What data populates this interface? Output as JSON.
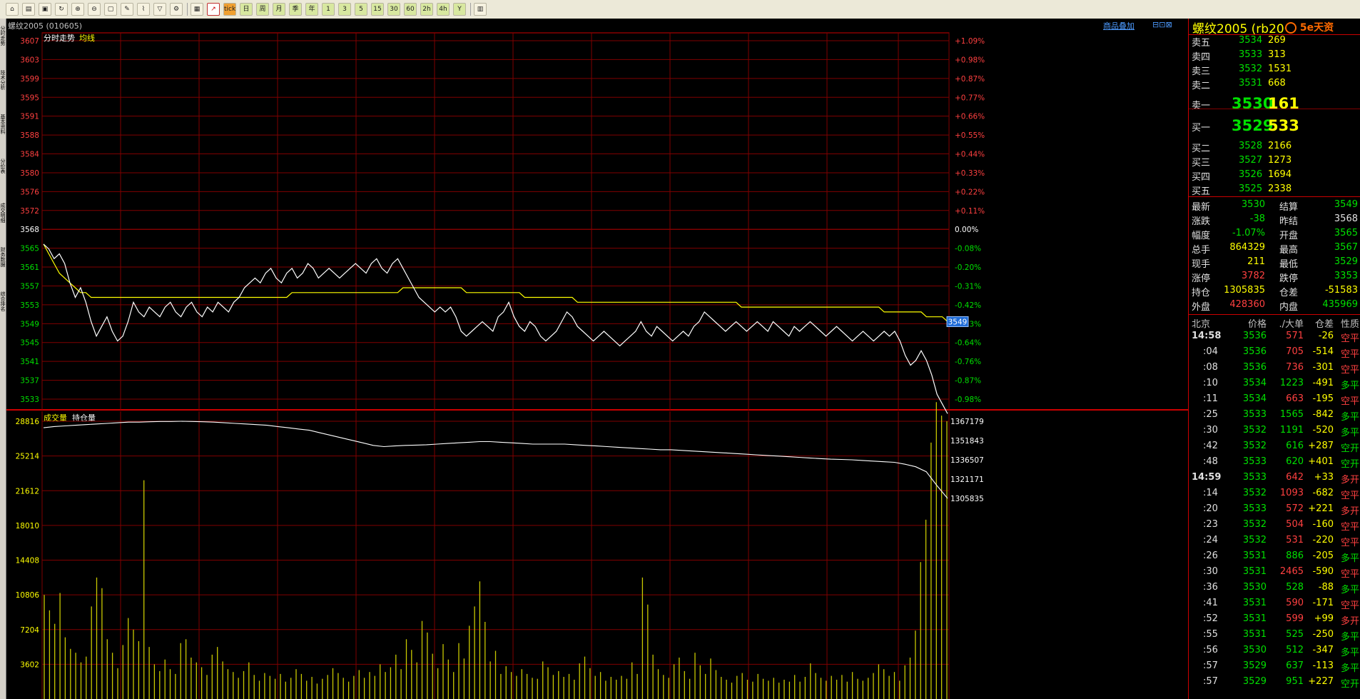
{
  "toolbar": {
    "buttons": [
      "home-icon",
      "book-icon",
      "note-icon",
      "refresh-icon",
      "zoom-in-icon",
      "zoom-out-icon",
      "window-icon",
      "pen-icon",
      "brush-icon",
      "filter-icon",
      "settings-icon",
      "table-icon",
      "chart-icon",
      "tick",
      "日",
      "周",
      "月",
      "季",
      "年",
      "1",
      "3",
      "5",
      "15",
      "30",
      "60",
      "2h",
      "4h",
      "Y",
      "calc-icon"
    ]
  },
  "left_tabs": [
    "分时走势",
    "技术分析",
    "基本资料",
    "分价表",
    "成交明细",
    "财务数据",
    "综合排名"
  ],
  "title": {
    "contract": "螺纹2005 (010605)",
    "overlay_button": "商品叠加",
    "window_buttons": [
      "⊟",
      "⊡",
      "⊠"
    ]
  },
  "chart_labels": {
    "price_panel": "分时走势",
    "avg_line": "均线",
    "vol_panel": "成交量",
    "oi_panel": "持仓量",
    "current_price_tag": "3549"
  },
  "chart_data": {
    "type": "line",
    "price_axis_labels": [
      "3607",
      "3603",
      "3599",
      "3595",
      "3591",
      "3588",
      "3584",
      "3580",
      "3576",
      "3572",
      "3568",
      "3565",
      "3561",
      "3557",
      "3553",
      "3549",
      "3545",
      "3541",
      "3537",
      "3533"
    ],
    "pct_axis_labels": [
      "+1.09%",
      "+0.98%",
      "+0.87%",
      "+0.77%",
      "+0.66%",
      "+0.55%",
      "+0.44%",
      "+0.33%",
      "+0.22%",
      "+0.11%",
      "0.00%",
      "-0.08%",
      "-0.20%",
      "-0.31%",
      "-0.42%",
      "-0.53%",
      "-0.64%",
      "-0.76%",
      "-0.87%",
      "-0.98%"
    ],
    "vol_axis_labels": [
      "28816",
      "25214",
      "21612",
      "18010",
      "14408",
      "10806",
      "7204",
      "3602"
    ],
    "oi_axis_labels": [
      "1367179",
      "1351843",
      "1336507",
      "1321171",
      "1305835"
    ],
    "price_ylim": [
      3531,
      3609
    ],
    "vol_ylim": [
      0,
      30000
    ],
    "oi_ylim": [
      1296000,
      1372000
    ],
    "price_series": [
      3565,
      3564,
      3562,
      3563,
      3561,
      3557,
      3554,
      3556,
      3553,
      3549,
      3546,
      3548,
      3550,
      3547,
      3545,
      3546,
      3549,
      3553,
      3551,
      3550,
      3552,
      3551,
      3550,
      3552,
      3553,
      3551,
      3550,
      3552,
      3553,
      3551,
      3550,
      3552,
      3551,
      3553,
      3552,
      3551,
      3553,
      3554,
      3556,
      3557,
      3558,
      3557,
      3559,
      3560,
      3558,
      3557,
      3559,
      3560,
      3558,
      3559,
      3561,
      3560,
      3558,
      3559,
      3560,
      3559,
      3558,
      3559,
      3560,
      3561,
      3560,
      3559,
      3561,
      3562,
      3560,
      3559,
      3561,
      3562,
      3560,
      3558,
      3556,
      3554,
      3553,
      3552,
      3551,
      3552,
      3551,
      3552,
      3550,
      3547,
      3546,
      3547,
      3548,
      3549,
      3548,
      3547,
      3550,
      3551,
      3553,
      3550,
      3548,
      3547,
      3549,
      3548,
      3546,
      3545,
      3546,
      3547,
      3549,
      3551,
      3550,
      3548,
      3547,
      3546,
      3545,
      3546,
      3547,
      3546,
      3545,
      3544,
      3545,
      3546,
      3547,
      3549,
      3547,
      3546,
      3548,
      3547,
      3546,
      3545,
      3546,
      3547,
      3546,
      3548,
      3549,
      3551,
      3550,
      3549,
      3548,
      3547,
      3548,
      3549,
      3548,
      3547,
      3548,
      3549,
      3548,
      3547,
      3549,
      3548,
      3547,
      3546,
      3548,
      3547,
      3548,
      3549,
      3548,
      3547,
      3546,
      3547,
      3548,
      3547,
      3546,
      3545,
      3546,
      3547,
      3546,
      3545,
      3546,
      3547,
      3546,
      3547,
      3545,
      3542,
      3540,
      3541,
      3543,
      3541,
      3538,
      3534,
      3532,
      3530
    ],
    "avg_series": [
      3565,
      3563,
      3561,
      3559,
      3558,
      3557,
      3556,
      3555,
      3555,
      3554,
      3554,
      3554,
      3554,
      3554,
      3554,
      3554,
      3554,
      3554,
      3554,
      3554,
      3554,
      3554,
      3554,
      3554,
      3554,
      3554,
      3554,
      3554,
      3554,
      3554,
      3554,
      3554,
      3554,
      3554,
      3554,
      3554,
      3554,
      3554,
      3554,
      3554,
      3554,
      3554,
      3554,
      3554,
      3554,
      3554,
      3554,
      3555,
      3555,
      3555,
      3555,
      3555,
      3555,
      3555,
      3555,
      3555,
      3555,
      3555,
      3555,
      3555,
      3555,
      3555,
      3555,
      3555,
      3555,
      3555,
      3555,
      3555,
      3556,
      3556,
      3556,
      3556,
      3556,
      3556,
      3556,
      3556,
      3556,
      3556,
      3556,
      3556,
      3555,
      3555,
      3555,
      3555,
      3555,
      3555,
      3555,
      3555,
      3555,
      3555,
      3555,
      3554,
      3554,
      3554,
      3554,
      3554,
      3554,
      3554,
      3554,
      3554,
      3554,
      3553,
      3553,
      3553,
      3553,
      3553,
      3553,
      3553,
      3553,
      3553,
      3553,
      3553,
      3553,
      3553,
      3553,
      3553,
      3553,
      3553,
      3553,
      3553,
      3553,
      3553,
      3553,
      3553,
      3553,
      3553,
      3553,
      3553,
      3553,
      3553,
      3553,
      3553,
      3552,
      3552,
      3552,
      3552,
      3552,
      3552,
      3552,
      3552,
      3552,
      3552,
      3552,
      3552,
      3552,
      3552,
      3552,
      3552,
      3552,
      3552,
      3552,
      3552,
      3552,
      3552,
      3552,
      3552,
      3552,
      3552,
      3552,
      3551,
      3551,
      3551,
      3551,
      3551,
      3551,
      3551,
      3551,
      3550,
      3550,
      3550,
      3550,
      3549
    ],
    "oi_series": [
      1362000,
      1363000,
      1363500,
      1364000,
      1364500,
      1365000,
      1365500,
      1366000,
      1366500,
      1366500,
      1366800,
      1367000,
      1367000,
      1367179,
      1367000,
      1366800,
      1366500,
      1366000,
      1365500,
      1365000,
      1364500,
      1364000,
      1363000,
      1362000,
      1361000,
      1360000,
      1358000,
      1356000,
      1354000,
      1352000,
      1350000,
      1348000,
      1347000,
      1347500,
      1348000,
      1348200,
      1348500,
      1349000,
      1349500,
      1350000,
      1350500,
      1351000,
      1351000,
      1350500,
      1350000,
      1349500,
      1349000,
      1349000,
      1349000,
      1349000,
      1348500,
      1348000,
      1347500,
      1347000,
      1346500,
      1346000,
      1345500,
      1345000,
      1344500,
      1344500,
      1344000,
      1343500,
      1343000,
      1342500,
      1342000,
      1341500,
      1341000,
      1340500,
      1340000,
      1339500,
      1339000,
      1338500,
      1338000,
      1337500,
      1337000,
      1336800,
      1336500,
      1336000,
      1335500,
      1335000,
      1334500,
      1333000,
      1331000,
      1327000,
      1316000,
      1305835
    ],
    "volume_bars": [
      10800,
      9200,
      7800,
      11000,
      6400,
      5200,
      4800,
      3800,
      4400,
      9600,
      12600,
      11500,
      6200,
      4800,
      3200,
      5600,
      8400,
      7200,
      6000,
      22700,
      5400,
      3600,
      2900,
      4100,
      3100,
      2600,
      5800,
      6200,
      4300,
      3800,
      3300,
      2500,
      4600,
      5400,
      3900,
      3100,
      2800,
      2200,
      2900,
      3800,
      2500,
      1900,
      2700,
      2400,
      2100,
      2600,
      1800,
      2200,
      3100,
      2600,
      1900,
      2300,
      1600,
      2100,
      2500,
      3200,
      2700,
      2200,
      1800,
      2400,
      3000,
      2200,
      2800,
      2400,
      3600,
      2800,
      3300,
      4600,
      3100,
      6200,
      5100,
      3800,
      8100,
      6900,
      4700,
      3200,
      5700,
      4100,
      2800,
      5800,
      4200,
      7600,
      9600,
      12200,
      8000,
      3900,
      5000,
      2600,
      3400,
      2800,
      2400,
      3100,
      2600,
      2200,
      2100,
      3900,
      3300,
      2500,
      2900,
      2300,
      2600,
      2000,
      3700,
      4400,
      3200,
      2400,
      2800,
      1900,
      2300,
      2000,
      2400,
      2100,
      3800,
      2600,
      12600,
      9800,
      4600,
      3100,
      2500,
      2200,
      3600,
      4300,
      2900,
      2100,
      4800,
      3500,
      2600,
      4200,
      3000,
      2300,
      2000,
      1700,
      2400,
      2700,
      2000,
      1800,
      2600,
      2100,
      1900,
      2200,
      1700,
      2000,
      1800,
      2500,
      1800,
      2300,
      3700,
      2700,
      2200,
      1900,
      2400,
      2000,
      2500,
      1800,
      2800,
      2100,
      1900,
      2200,
      2700,
      3600,
      3100,
      2400,
      2800,
      1900,
      3500,
      4300,
      7100,
      14200,
      18600,
      26600,
      30800,
      29400,
      28816
    ]
  },
  "quote": {
    "title": "螺纹2005 (rb2005)",
    "brand": "5e天资",
    "sell": [
      {
        "label": "卖五",
        "price": "3534",
        "vol": "269"
      },
      {
        "label": "卖四",
        "price": "3533",
        "vol": "313"
      },
      {
        "label": "卖三",
        "price": "3532",
        "vol": "1531"
      },
      {
        "label": "卖二",
        "price": "3531",
        "vol": "668"
      },
      {
        "label": "卖一",
        "price": "3530",
        "vol": "161"
      }
    ],
    "buy": [
      {
        "label": "买一",
        "price": "3529",
        "vol": "533"
      },
      {
        "label": "买二",
        "price": "3528",
        "vol": "2166"
      },
      {
        "label": "买三",
        "price": "3527",
        "vol": "1273"
      },
      {
        "label": "买四",
        "price": "3526",
        "vol": "1694"
      },
      {
        "label": "买五",
        "price": "3525",
        "vol": "2338"
      }
    ],
    "stats": [
      {
        "l1": "最新",
        "v1": "3530",
        "c1": "green",
        "l2": "结算",
        "v2": "3549",
        "c2": "green"
      },
      {
        "l1": "涨跌",
        "v1": "-38",
        "c1": "green",
        "l2": "昨结",
        "v2": "3568",
        "c2": "white"
      },
      {
        "l1": "幅度",
        "v1": "-1.07%",
        "c1": "green",
        "l2": "开盘",
        "v2": "3565",
        "c2": "green"
      },
      {
        "l1": "总手",
        "v1": "864329",
        "c1": "yellow",
        "l2": "最高",
        "v2": "3567",
        "c2": "green"
      },
      {
        "l1": "现手",
        "v1": "211",
        "c1": "yellow",
        "l2": "最低",
        "v2": "3529",
        "c2": "green"
      },
      {
        "l1": "涨停",
        "v1": "3782",
        "c1": "red",
        "l2": "跌停",
        "v2": "3353",
        "c2": "green"
      },
      {
        "l1": "持仓",
        "v1": "1305835",
        "c1": "yellow",
        "l2": "仓差",
        "v2": "-51583",
        "c2": "yellow"
      },
      {
        "l1": "外盘",
        "v1": "428360",
        "c1": "red",
        "l2": "内盘",
        "v2": "435969",
        "c2": "green"
      }
    ]
  },
  "ticks_header": {
    "time": "北京",
    "price": "价格",
    "vol": "./大单",
    "diff": "仓差",
    "nature": "性质"
  },
  "ticks": [
    {
      "t": "14:58",
      "p": "3536",
      "v": "571",
      "d": "-26",
      "n": "空平",
      "pc": "green",
      "vc": "red",
      "nc": "red",
      "bold": true
    },
    {
      "t": ":04",
      "p": "3536",
      "v": "705",
      "d": "-514",
      "n": "空平",
      "pc": "green",
      "vc": "red",
      "nc": "red"
    },
    {
      "t": ":08",
      "p": "3536",
      "v": "736",
      "d": "-301",
      "n": "空平",
      "pc": "green",
      "vc": "red",
      "nc": "red"
    },
    {
      "t": ":10",
      "p": "3534",
      "v": "1223",
      "d": "-491",
      "n": "多平",
      "pc": "green",
      "vc": "green",
      "nc": "green"
    },
    {
      "t": ":11",
      "p": "3534",
      "v": "663",
      "d": "-195",
      "n": "空平",
      "pc": "green",
      "vc": "red",
      "nc": "red"
    },
    {
      "t": ":25",
      "p": "3533",
      "v": "1565",
      "d": "-842",
      "n": "多平",
      "pc": "green",
      "vc": "green",
      "nc": "green"
    },
    {
      "t": ":30",
      "p": "3532",
      "v": "1191",
      "d": "-520",
      "n": "多平",
      "pc": "green",
      "vc": "green",
      "nc": "green"
    },
    {
      "t": ":42",
      "p": "3532",
      "v": "616",
      "d": "+287",
      "n": "空开",
      "pc": "green",
      "vc": "green",
      "nc": "green"
    },
    {
      "t": ":48",
      "p": "3533",
      "v": "620",
      "d": "+401",
      "n": "空开",
      "pc": "green",
      "vc": "green",
      "nc": "green"
    },
    {
      "t": "14:59",
      "p": "3533",
      "v": "642",
      "d": "+33",
      "n": "多开",
      "pc": "green",
      "vc": "red",
      "nc": "red",
      "bold": true
    },
    {
      "t": ":14",
      "p": "3532",
      "v": "1093",
      "d": "-682",
      "n": "空平",
      "pc": "green",
      "vc": "red",
      "nc": "red"
    },
    {
      "t": ":20",
      "p": "3533",
      "v": "572",
      "d": "+221",
      "n": "多开",
      "pc": "green",
      "vc": "red",
      "nc": "red"
    },
    {
      "t": ":23",
      "p": "3532",
      "v": "504",
      "d": "-160",
      "n": "空平",
      "pc": "green",
      "vc": "red",
      "nc": "red"
    },
    {
      "t": ":24",
      "p": "3532",
      "v": "531",
      "d": "-220",
      "n": "空平",
      "pc": "green",
      "vc": "red",
      "nc": "red"
    },
    {
      "t": ":26",
      "p": "3531",
      "v": "886",
      "d": "-205",
      "n": "多平",
      "pc": "green",
      "vc": "green",
      "nc": "green"
    },
    {
      "t": ":30",
      "p": "3531",
      "v": "2465",
      "d": "-590",
      "n": "空平",
      "pc": "green",
      "vc": "red",
      "nc": "red"
    },
    {
      "t": ":36",
      "p": "3530",
      "v": "528",
      "d": "-88",
      "n": "多平",
      "pc": "green",
      "vc": "green",
      "nc": "green"
    },
    {
      "t": ":41",
      "p": "3531",
      "v": "590",
      "d": "-171",
      "n": "空平",
      "pc": "green",
      "vc": "red",
      "nc": "red"
    },
    {
      "t": ":52",
      "p": "3531",
      "v": "599",
      "d": "+99",
      "n": "多开",
      "pc": "green",
      "vc": "red",
      "nc": "red"
    },
    {
      "t": ":55",
      "p": "3531",
      "v": "525",
      "d": "-250",
      "n": "多平",
      "pc": "green",
      "vc": "green",
      "nc": "green"
    },
    {
      "t": ":56",
      "p": "3530",
      "v": "512",
      "d": "-347",
      "n": "多平",
      "pc": "green",
      "vc": "green",
      "nc": "green"
    },
    {
      "t": ":57",
      "p": "3529",
      "v": "637",
      "d": "-113",
      "n": "多平",
      "pc": "green",
      "vc": "green",
      "nc": "green"
    },
    {
      "t": ":57",
      "p": "3529",
      "v": "951",
      "d": "+227",
      "n": "空开",
      "pc": "green",
      "vc": "green",
      "nc": "green"
    }
  ],
  "colors": {
    "grid": "#800000",
    "border": "#cc0000",
    "price_line": "#ffffff",
    "avg_line": "#ffff00",
    "volume": "#c8c800",
    "up": "#ff4040",
    "down": "#00e000",
    "label": "#ffff00"
  }
}
